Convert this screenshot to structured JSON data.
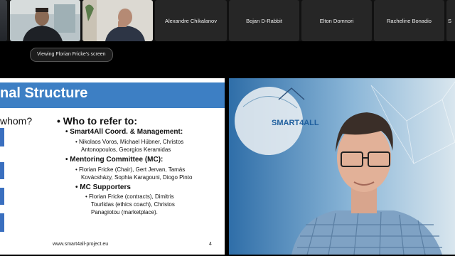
{
  "participants": [
    {
      "name": "Alexandre Chikalanov"
    },
    {
      "name": "Bojan D-Rabbit"
    },
    {
      "name": "Elton Domnori"
    },
    {
      "name": "Racheline Bonadio"
    },
    {
      "name": "S"
    }
  ],
  "share_indicator": "Viewing Florian Fricke's screen",
  "slide": {
    "title": "nal Structure",
    "left_heading": "whom?",
    "right_heading": "Who to refer to:",
    "sections": [
      {
        "heading": "Smart4All Coord. & Management:",
        "lines": [
          "Nikolaos Voros, Michael Hübner, Christos",
          "Antonopoulos, Georgios Keramidas"
        ]
      },
      {
        "heading": "Mentoring Committee (MC):",
        "lines": [
          "Florian Fricke (Chair), Gert Jervan, Tamás",
          "Kovácsházy, Sophia Karagouni, Diogo Pinto"
        ]
      },
      {
        "heading": "MC Supporters",
        "lines": [
          "Florian Fricke (contracts), Dimitris",
          "Tourlidas (ethics coach), Christos",
          "Panagiotou (marketplace)."
        ]
      }
    ],
    "footer": "www.smart4all-project.eu",
    "page_number": "4"
  },
  "camera": {
    "logo_text": "SMART4ALL"
  },
  "colors": {
    "slide_banner": "#3d7fc4",
    "accent": "#3a6fbf",
    "tile_bg": "#262626"
  }
}
